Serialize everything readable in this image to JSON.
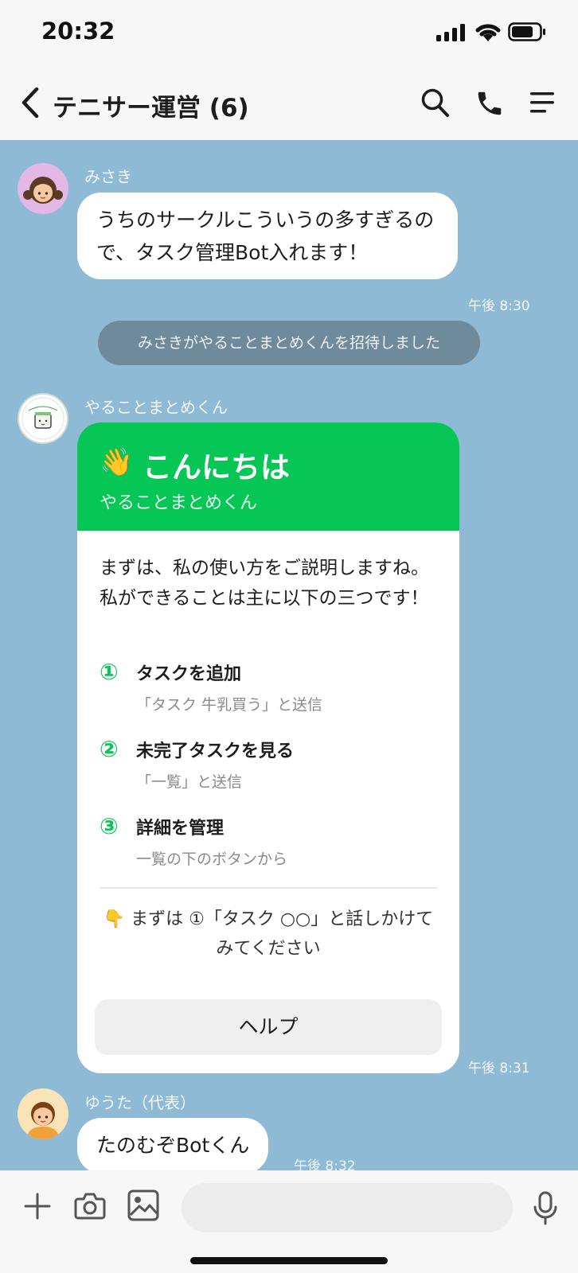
{
  "status_bar": {
    "time": "20:32"
  },
  "header": {
    "title": "テニサー運営 (6)"
  },
  "messages": {
    "m1": {
      "sender": "みさき",
      "text": "うちのサークルこういうの多すぎるので、タスク管理Bot入れます！",
      "time": "午後 8:30"
    },
    "system": {
      "text": "みさきがやることまとめくんを招待しました"
    },
    "m2": {
      "sender": "やることまとめくん",
      "card": {
        "greeting_emoji": "👋",
        "greeting": "こんにちは",
        "subtitle": "やることまとめくん",
        "intro": "まずは、私の使い方をご説明しますね。私ができることは主に以下の三つです！",
        "items": [
          {
            "num": "①",
            "title": "タスクを追加",
            "desc": "「タスク 牛乳買う」と送信"
          },
          {
            "num": "②",
            "title": "未完了タスクを見る",
            "desc": "「一覧」と送信"
          },
          {
            "num": "③",
            "title": "詳細を管理",
            "desc": "一覧の下のボタンから"
          }
        ],
        "hint_emoji": "👇",
        "hint": "まずは ①「タスク ○○」と話しかけてみてください",
        "button": "ヘルプ"
      },
      "time": "午後 8:31"
    },
    "m3": {
      "sender": "ゆうた（代表）",
      "text": "たのむぞBotくん",
      "time": "午後 8:32"
    }
  },
  "icons": {
    "back": "chevron-left-icon",
    "search": "search-icon",
    "call": "phone-icon",
    "menu": "menu-icon",
    "plus": "plus-icon",
    "camera": "camera-icon",
    "image": "image-icon",
    "mic": "mic-icon"
  },
  "colors": {
    "chat_bg": "#8fbad5",
    "accent": "#06c755",
    "system_bg": "#6f8a9b"
  }
}
